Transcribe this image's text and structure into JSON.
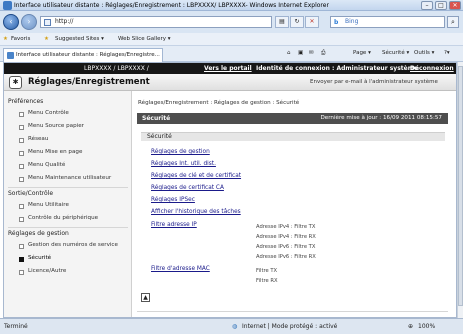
{
  "window": {
    "title": "Interface utilisateur distante : Réglages/Enregistrement : LBPXXXX/ LBPXXXX- Windows Internet Explorer",
    "controls": [
      "–",
      "□",
      "✕"
    ]
  },
  "address": {
    "url": "http://",
    "search_placeholder": "Bing",
    "search_logo": "b"
  },
  "favorites": {
    "label": "Favoris",
    "items": [
      "Suggested Sites ▾",
      "Web Slice Gallery ▾"
    ]
  },
  "tab": {
    "label": "Interface utilisateur distante : Réglages/Enregistre..."
  },
  "commandbar": {
    "page": "Page ▾",
    "security": "Sécurité ▾",
    "tools": "Outils ▾",
    "help": "?▾"
  },
  "app": {
    "device": "LBPXXXX / LBPXXXX /",
    "portal_link": "Vers le portail",
    "login": "Identité de connexion : Administrateur système",
    "logout": "Déconnexion",
    "title": "Réglages/Enregistrement",
    "mail_link": "Envoyer par e-mail à l'administrateur système"
  },
  "sidebar": {
    "sections": [
      {
        "label": "Préférences",
        "items": [
          "Menu Contrôle",
          "Menu Source papier",
          "Réseau",
          "Menu Mise en page",
          "Menu Qualité",
          "Menu Maintenance utilisateur"
        ]
      },
      {
        "label": "Sortie/Contrôle",
        "items": [
          "Menu Utilitaire",
          "Contrôle du périphérique"
        ]
      },
      {
        "label": "Réglages de gestion",
        "items": [
          "Gestion des numéros de service",
          "Sécurité",
          "Licence/Autre"
        ]
      }
    ],
    "selected": "Sécurité"
  },
  "main": {
    "breadcrumb": "Réglages/Enregistrement : Réglages de gestion : Sécurité",
    "section_title": "Sécurité",
    "last_update": "Dernière mise à jour : 16/09 2011 08:15:57",
    "sub_header": "Sécurité",
    "links": [
      "Réglages de gestion",
      "Réglages Int. util. dist.",
      "Réglages de clé et de certificat",
      "Réglages de certificat CA",
      "Réglages IPSec",
      "Afficher l'historique des tâches",
      "Filtre adresse IP",
      "Filtre d'adresse MAC"
    ],
    "ip_filters": [
      "Adresse IPv4 : Filtre TX",
      "Adresse IPv4 : Filtre RX",
      "Adresse IPv6 : Filtre TX",
      "Adresse IPv6 : Filtre RX"
    ],
    "mac_filters": [
      "Filtre TX",
      "Filtre RX"
    ]
  },
  "status": {
    "left": "Terminé",
    "zone": "Internet | Mode protégé : activé",
    "zoom": "100%"
  }
}
